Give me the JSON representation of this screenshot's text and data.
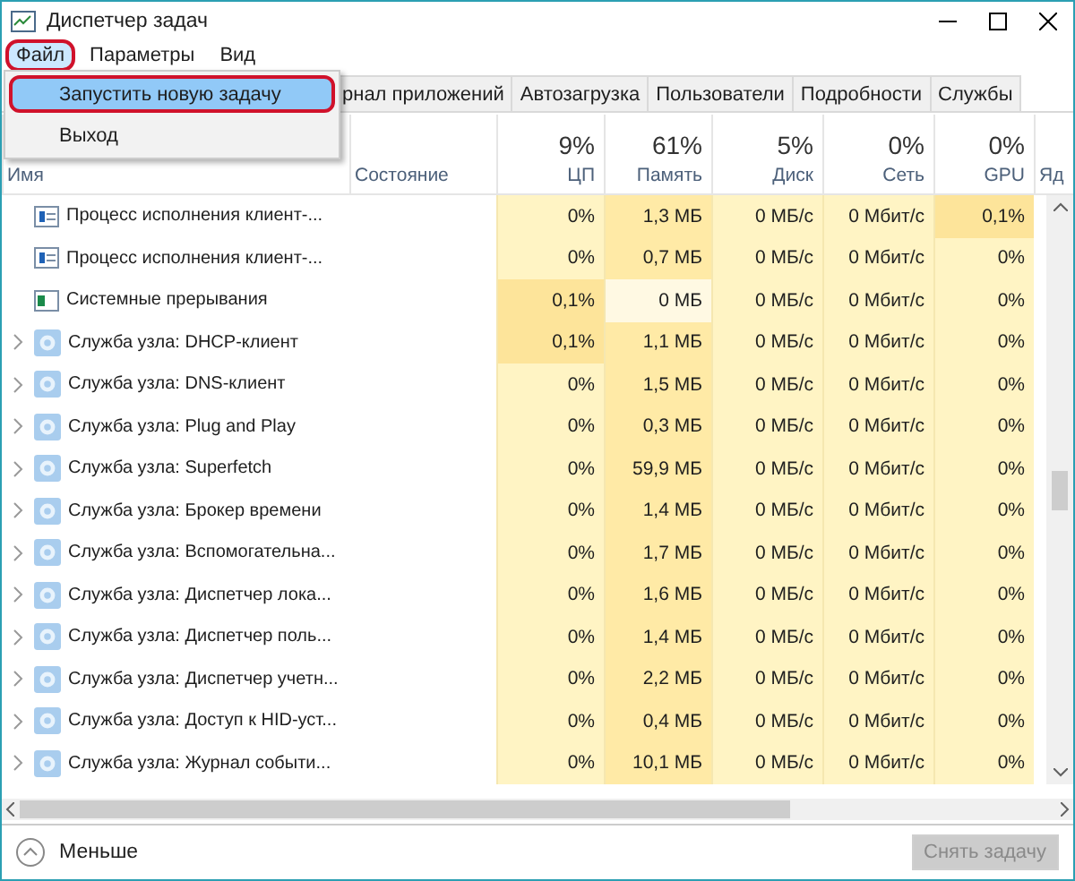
{
  "window": {
    "title": "Диспетчер задач"
  },
  "menu": [
    {
      "label": "Файл",
      "open": true,
      "circled": true
    },
    {
      "label": "Параметры",
      "open": false,
      "circled": false
    },
    {
      "label": "Вид",
      "open": false,
      "circled": false
    }
  ],
  "file_menu": [
    {
      "label": "Запустить новую задачу",
      "selected": true,
      "circled": true
    },
    {
      "label": "Выход",
      "selected": false,
      "circled": false
    }
  ],
  "tabs": [
    {
      "label": "рнал приложений",
      "selected": false
    },
    {
      "label": "Автозагрузка",
      "selected": false
    },
    {
      "label": "Пользователи",
      "selected": false
    },
    {
      "label": "Подробности",
      "selected": false
    },
    {
      "label": "Службы",
      "selected": false
    }
  ],
  "columns": [
    {
      "label": "Имя"
    },
    {
      "label": "Состояние"
    },
    {
      "label": "ЦП",
      "summary": "9%"
    },
    {
      "label": "Память",
      "summary": "61%"
    },
    {
      "label": "Диск",
      "summary": "5%"
    },
    {
      "label": "Сеть",
      "summary": "0%"
    },
    {
      "label": "GPU",
      "summary": "0%"
    },
    {
      "label": "Яд"
    }
  ],
  "rows": [
    {
      "kind": "process",
      "expandable": false,
      "name": "Процесс исполнения клиент-...",
      "cells": [
        {
          "value": "0%"
        },
        {
          "value": "1,3 МБ"
        },
        {
          "value": "0 МБ/с"
        },
        {
          "value": "0 Мбит/с"
        },
        {
          "value": "0,1%",
          "color": "#fde49a"
        }
      ]
    },
    {
      "kind": "process",
      "expandable": false,
      "name": "Процесс исполнения клиент-...",
      "cells": [
        {
          "value": "0%"
        },
        {
          "value": "0,7 МБ"
        },
        {
          "value": "0 МБ/с"
        },
        {
          "value": "0 Мбит/с"
        },
        {
          "value": "0%"
        }
      ]
    },
    {
      "kind": "interrupts",
      "expandable": false,
      "name": "Системные прерывания",
      "cells": [
        {
          "value": "0,1%",
          "color": "#fde49a"
        },
        {
          "value": "0 МБ",
          "color": "#fff9e3"
        },
        {
          "value": "0 МБ/с"
        },
        {
          "value": "0 Мбит/с"
        },
        {
          "value": "0%"
        }
      ]
    },
    {
      "kind": "service",
      "expandable": true,
      "name": "Служба узла: DHCP-клиент",
      "cells": [
        {
          "value": "0,1%",
          "color": "#fde49a"
        },
        {
          "value": "1,1 МБ"
        },
        {
          "value": "0 МБ/с"
        },
        {
          "value": "0 Мбит/с"
        },
        {
          "value": "0%"
        }
      ]
    },
    {
      "kind": "service",
      "expandable": true,
      "name": "Служба узла: DNS-клиент",
      "cells": [
        {
          "value": "0%"
        },
        {
          "value": "1,5 МБ"
        },
        {
          "value": "0 МБ/с"
        },
        {
          "value": "0 Мбит/с"
        },
        {
          "value": "0%"
        }
      ]
    },
    {
      "kind": "service",
      "expandable": true,
      "name": "Служба узла: Plug and Play",
      "cells": [
        {
          "value": "0%"
        },
        {
          "value": "0,3 МБ"
        },
        {
          "value": "0 МБ/с"
        },
        {
          "value": "0 Мбит/с"
        },
        {
          "value": "0%"
        }
      ]
    },
    {
      "kind": "service",
      "expandable": true,
      "name": "Служба узла: Superfetch",
      "cells": [
        {
          "value": "0%"
        },
        {
          "value": "59,9 МБ"
        },
        {
          "value": "0 МБ/с"
        },
        {
          "value": "0 Мбит/с"
        },
        {
          "value": "0%"
        }
      ]
    },
    {
      "kind": "service",
      "expandable": true,
      "name": "Служба узла: Брокер времени",
      "cells": [
        {
          "value": "0%"
        },
        {
          "value": "1,4 МБ"
        },
        {
          "value": "0 МБ/с"
        },
        {
          "value": "0 Мбит/с"
        },
        {
          "value": "0%"
        }
      ]
    },
    {
      "kind": "service",
      "expandable": true,
      "name": "Служба узла: Вспомогательна...",
      "cells": [
        {
          "value": "0%"
        },
        {
          "value": "1,7 МБ"
        },
        {
          "value": "0 МБ/с"
        },
        {
          "value": "0 Мбит/с"
        },
        {
          "value": "0%"
        }
      ]
    },
    {
      "kind": "service",
      "expandable": true,
      "name": "Служба узла: Диспетчер лока...",
      "cells": [
        {
          "value": "0%"
        },
        {
          "value": "1,6 МБ"
        },
        {
          "value": "0 МБ/с"
        },
        {
          "value": "0 Мбит/с"
        },
        {
          "value": "0%"
        }
      ]
    },
    {
      "kind": "service",
      "expandable": true,
      "name": "Служба узла: Диспетчер поль...",
      "cells": [
        {
          "value": "0%"
        },
        {
          "value": "1,4 МБ"
        },
        {
          "value": "0 МБ/с"
        },
        {
          "value": "0 Мбит/с"
        },
        {
          "value": "0%"
        }
      ]
    },
    {
      "kind": "service",
      "expandable": true,
      "name": "Служба узла: Диспетчер учетн...",
      "cells": [
        {
          "value": "0%"
        },
        {
          "value": "2,2 МБ"
        },
        {
          "value": "0 МБ/с"
        },
        {
          "value": "0 Мбит/с"
        },
        {
          "value": "0%"
        }
      ]
    },
    {
      "kind": "service",
      "expandable": true,
      "name": "Служба узла: Доступ к HID-уст...",
      "cells": [
        {
          "value": "0%"
        },
        {
          "value": "0,4 МБ"
        },
        {
          "value": "0 МБ/с"
        },
        {
          "value": "0 Мбит/с"
        },
        {
          "value": "0%"
        }
      ]
    },
    {
      "kind": "service",
      "expandable": true,
      "name": "Служба узла: Журнал событи...",
      "cells": [
        {
          "value": "0%"
        },
        {
          "value": "10,1 МБ"
        },
        {
          "value": "0 МБ/с"
        },
        {
          "value": "0 Мбит/с"
        },
        {
          "value": "0%"
        }
      ]
    }
  ],
  "footer": {
    "toggle": "Меньше",
    "end_task": {
      "label": "Снять задачу",
      "disabled": true
    }
  }
}
